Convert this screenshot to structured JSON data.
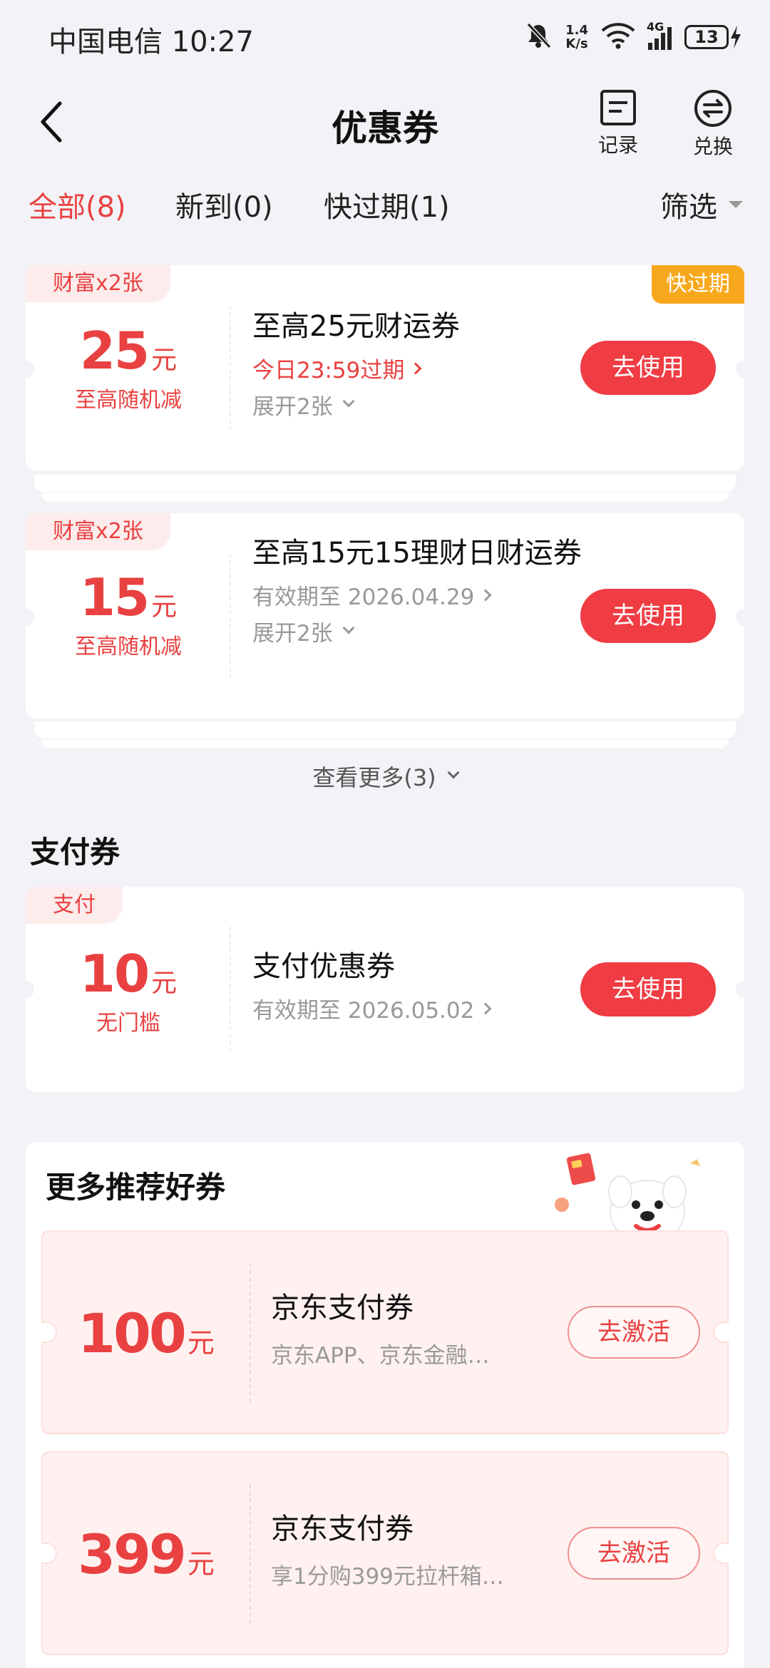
{
  "status_bar": {
    "carrier_time": "中国电信 10:27",
    "speed_value": "1.4",
    "speed_unit": "K/s",
    "network": "4G",
    "battery": "13"
  },
  "nav": {
    "title": "优惠券",
    "records_label": "记录",
    "exchange_label": "兑换"
  },
  "tabs": [
    {
      "label": "全部(8)",
      "active": true
    },
    {
      "label": "新到(0)",
      "active": false
    },
    {
      "label": "快过期(1)",
      "active": false
    }
  ],
  "filter_label": "筛选",
  "coupons": [
    {
      "tag": "财富x2张",
      "expiring_badge": "快过期",
      "amount": "25",
      "unit": "元",
      "condition": "至高随机减",
      "title": "至高25元财运券",
      "validity": "今日23:59过期",
      "expand": "展开2张",
      "button": "去使用"
    },
    {
      "tag": "财富x2张",
      "amount": "15",
      "unit": "元",
      "condition": "至高随机减",
      "title": "至高15元15理财日财运券",
      "validity": "有效期至 2026.04.29",
      "expand": "展开2张",
      "button": "去使用"
    }
  ],
  "see_more": "查看更多(3)",
  "payment_section": {
    "title": "支付券",
    "coupon": {
      "tag": "支付",
      "amount": "10",
      "unit": "元",
      "condition": "无门槛",
      "title": "支付优惠券",
      "validity": "有效期至 2026.05.02",
      "button": "去使用"
    }
  },
  "recommend": {
    "title": "更多推荐好券",
    "items": [
      {
        "amount": "100",
        "unit": "元",
        "title": "京东支付券",
        "desc": "京东APP、京东金融…",
        "button": "去激活"
      },
      {
        "amount": "399",
        "unit": "元",
        "title": "京东支付券",
        "desc": "享1分购399元拉杆箱…",
        "button": "去激活"
      }
    ]
  },
  "colors": {
    "accent": "#e94141",
    "button": "#f03c43",
    "expiring": "#f8a81d"
  }
}
